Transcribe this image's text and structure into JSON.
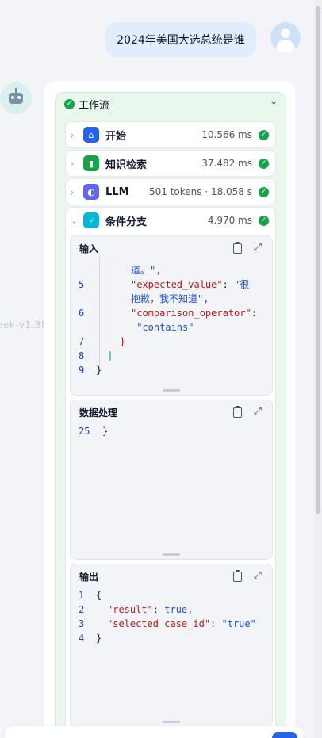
{
  "conversation": {
    "user_message": "2024年美国大选总统是谁",
    "background_hint": "eek-v1.3B"
  },
  "workflow": {
    "title": "工作流",
    "status": "success",
    "nodes": [
      {
        "label": "开始",
        "meta": "10.566 ms",
        "icon": "home-icon",
        "color": "#2563eb"
      },
      {
        "label": "知识检索",
        "meta": "37.482 ms",
        "icon": "book-icon",
        "color": "#16a34a"
      },
      {
        "label": "LLM",
        "meta": "501 tokens · 18.058 s",
        "icon": "llm-icon",
        "color": "#6366f1"
      },
      {
        "label": "条件分支",
        "meta": "4.970 ms",
        "icon": "branch-icon",
        "color": "#06b6d4"
      }
    ]
  },
  "panels": {
    "input": {
      "title": "输入",
      "lines": [
        {
          "no": "",
          "parts": [
            {
              "t": "道。\",",
              "c": "s"
            }
          ]
        },
        {
          "no": "5",
          "parts": [
            {
              "t": "\"expected_value\"",
              "c": "k"
            },
            {
              "t": ": ",
              "c": "p"
            },
            {
              "t": "\"很",
              "c": "s"
            }
          ]
        },
        {
          "no": "",
          "parts": [
            {
              "t": "抱歉，我不知道\",",
              "c": "s"
            }
          ]
        },
        {
          "no": "6",
          "parts": [
            {
              "t": "\"comparison_operator\"",
              "c": "k"
            },
            {
              "t": ":",
              "c": "p"
            }
          ]
        },
        {
          "no": "",
          "parts": [
            {
              "t": " \"contains\"",
              "c": "s"
            }
          ]
        },
        {
          "no": "7",
          "parts": [
            {
              "t": "}",
              "c": "k"
            }
          ]
        },
        {
          "no": "8",
          "parts": [
            {
              "t": "]",
              "c": "g"
            }
          ]
        },
        {
          "no": "9",
          "parts": [
            {
              "t": "}",
              "c": "p"
            }
          ]
        }
      ]
    },
    "process": {
      "title": "数据处理",
      "lines": [
        {
          "no": "25",
          "parts": [
            {
              "t": "}",
              "c": "p"
            }
          ]
        }
      ]
    },
    "output": {
      "title": "输出",
      "lines": [
        {
          "no": "1",
          "parts": [
            {
              "t": "{",
              "c": "p"
            }
          ]
        },
        {
          "no": "2",
          "parts": [
            {
              "t": "\"result\"",
              "c": "k"
            },
            {
              "t": ": ",
              "c": "p"
            },
            {
              "t": "true",
              "c": "v"
            },
            {
              "t": ",",
              "c": "p"
            }
          ]
        },
        {
          "no": "3",
          "parts": [
            {
              "t": "\"selected_case_id\"",
              "c": "k"
            },
            {
              "t": ": ",
              "c": "p"
            },
            {
              "t": "\"true\"",
              "c": "s"
            }
          ]
        },
        {
          "no": "4",
          "parts": [
            {
              "t": "}",
              "c": "p"
            }
          ]
        }
      ]
    }
  },
  "colors": {
    "success": "#17a34a",
    "accent": "#2563eb",
    "workflow_bg": "#e9f7ec"
  }
}
